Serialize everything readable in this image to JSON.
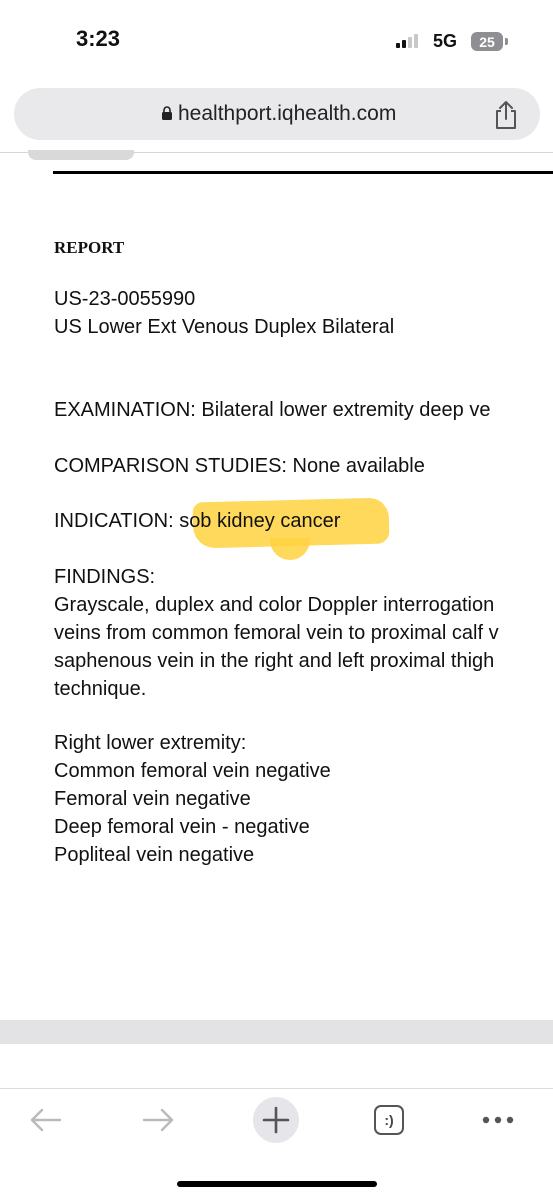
{
  "status_bar": {
    "time": "3:23",
    "network": "5G",
    "battery": "25"
  },
  "browser": {
    "url": "healthport.iqhealth.com"
  },
  "report": {
    "heading": "REPORT",
    "accession": "US-23-0055990",
    "exam_title": "US Lower Ext Venous Duplex Bilateral",
    "examination": "EXAMINATION: Bilateral lower extremity deep ve",
    "comparison": "COMPARISON STUDIES: None available",
    "indication_label": "INDICATION: ",
    "indication_value": "sob kidney cancer",
    "findings_heading": "FINDINGS:",
    "findings_lines": [
      "Grayscale, duplex and color Doppler interrogation",
      "veins from common femoral vein to proximal calf v",
      "saphenous vein in the right and left proximal thigh",
      "technique."
    ],
    "right_heading": "Right lower extremity:",
    "right_items": [
      "Common femoral vein negative",
      "Femoral vein negative",
      "Deep femoral vein - negative",
      "Popliteal vein negative"
    ]
  },
  "toolbar": {
    "back_icon": "back-arrow-icon",
    "forward_icon": "forward-arrow-icon",
    "new_tab_icon": "plus-icon",
    "tabs_icon": "tabs-icon",
    "tabs_label": ":)",
    "menu_icon": "more-icon"
  },
  "colors": {
    "highlight": "#ffd23f",
    "url_bar_bg": "#e9e9ec"
  }
}
